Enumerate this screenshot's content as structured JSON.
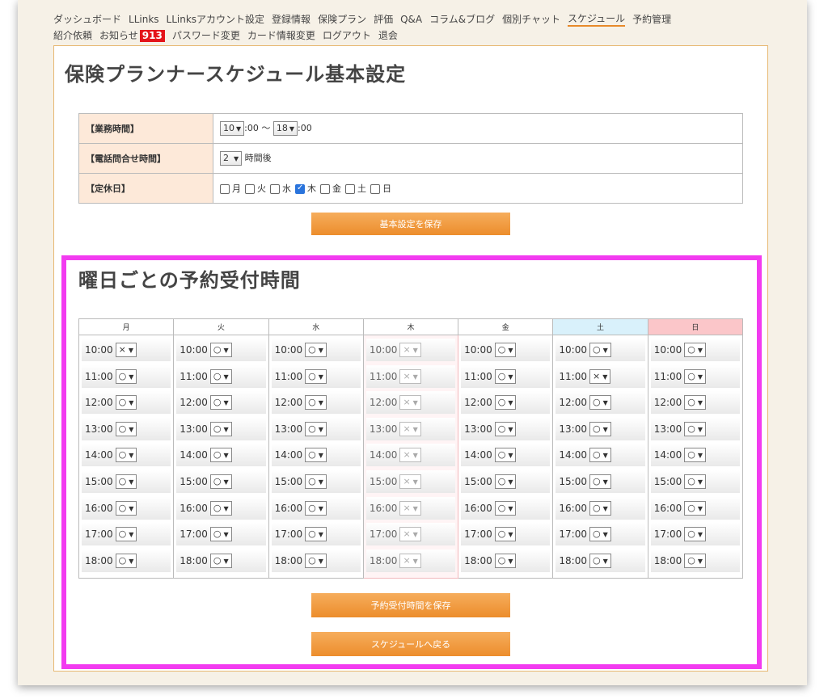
{
  "nav": {
    "row1": [
      "ダッシュボード",
      "LLinks",
      "LLinksアカウント設定",
      "登録情報",
      "保険プラン",
      "評価",
      "Q&A",
      "コラム&ブログ",
      "個別チャット",
      "スケジュール",
      "予約管理"
    ],
    "row2_a": [
      "紹介依頼"
    ],
    "notice_label": "お知らせ",
    "notice_badge": "913",
    "row2_b": [
      "パスワード変更",
      "カード情報変更",
      "ログアウト",
      "退会"
    ],
    "active": "スケジュール"
  },
  "basic": {
    "title": "保険プランナースケジュール基本設定",
    "business_hours_label": "【業務時間】",
    "start_hour": "10",
    "end_hour": "18",
    "suffix_00": ":00",
    "tilde": "～",
    "phone_label": "【電話問合せ時間】",
    "phone_hours": "2",
    "phone_suffix": "時間後",
    "closed_label": "【定休日】",
    "closed_days": [
      {
        "day": "月",
        "checked": false
      },
      {
        "day": "火",
        "checked": false
      },
      {
        "day": "水",
        "checked": false
      },
      {
        "day": "木",
        "checked": true
      },
      {
        "day": "金",
        "checked": false
      },
      {
        "day": "土",
        "checked": false
      },
      {
        "day": "日",
        "checked": false
      }
    ],
    "save_button": "基本設定を保存"
  },
  "weekly": {
    "title": "曜日ごとの予約受付時間",
    "times": [
      "10:00",
      "11:00",
      "12:00",
      "13:00",
      "14:00",
      "15:00",
      "16:00",
      "17:00",
      "18:00"
    ],
    "days": [
      {
        "name": "月",
        "style": "",
        "disabled": false,
        "values": [
          "×",
          "○",
          "○",
          "○",
          "○",
          "○",
          "○",
          "○",
          "○"
        ]
      },
      {
        "name": "火",
        "style": "",
        "disabled": false,
        "values": [
          "○",
          "○",
          "○",
          "○",
          "○",
          "○",
          "○",
          "○",
          "○"
        ]
      },
      {
        "name": "水",
        "style": "",
        "disabled": false,
        "values": [
          "○",
          "○",
          "○",
          "○",
          "○",
          "○",
          "○",
          "○",
          "○"
        ]
      },
      {
        "name": "木",
        "style": "",
        "disabled": true,
        "values": [
          "×",
          "×",
          "×",
          "×",
          "×",
          "×",
          "×",
          "×",
          "×"
        ]
      },
      {
        "name": "金",
        "style": "",
        "disabled": false,
        "values": [
          "○",
          "○",
          "○",
          "○",
          "○",
          "○",
          "○",
          "○",
          "○"
        ]
      },
      {
        "name": "土",
        "style": "sat",
        "disabled": false,
        "values": [
          "○",
          "×",
          "○",
          "○",
          "○",
          "○",
          "○",
          "○",
          "○"
        ]
      },
      {
        "name": "日",
        "style": "sun",
        "disabled": false,
        "values": [
          "○",
          "○",
          "○",
          "○",
          "○",
          "○",
          "○",
          "○",
          "○"
        ]
      }
    ],
    "save_button": "予約受付時間を保存",
    "back_button": "スケジュールへ戻る"
  },
  "colors": {
    "accent": "#ec8d2c",
    "highlight": "#f23bf0",
    "badge": "#e4141a",
    "sat": "#d9f1fb",
    "sun": "#fbc6c9"
  }
}
